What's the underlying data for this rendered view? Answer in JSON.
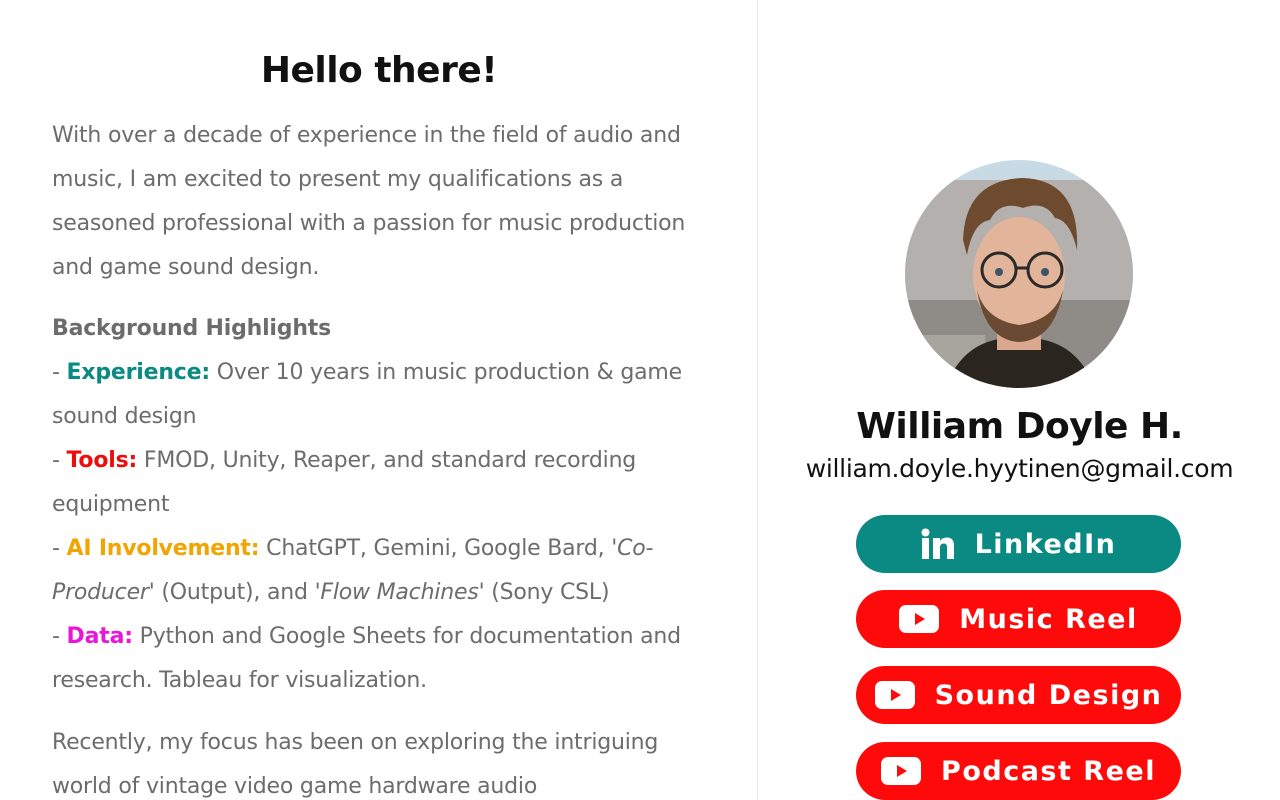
{
  "main": {
    "greeting": "Hello there!",
    "intro": "With over a decade of experience in the field of audio and music, I am excited to present my qualifications as a seasoned professional with a passion for music production and game sound design.",
    "highlights": {
      "heading": "Background Highlights",
      "dash": "- ",
      "experience": {
        "label": "Experience:",
        "text": " Over 10 years in music production & game sound design"
      },
      "tools": {
        "label": "Tools:",
        "text": " FMOD, Unity, Reaper, and standard recording equipment"
      },
      "ai": {
        "label": "AI Involvement:",
        "text_a": " ChatGPT, Gemini, Google Bard, ",
        "italic_a": "'Co-Producer'",
        "text_b": " (Output), and ",
        "italic_b": "'Flow Machines'",
        "text_c": " (Sony CSL)"
      },
      "data": {
        "label": "Data:",
        "text": " Python and Google Sheets for documentation and research. Tableau for visualization."
      }
    },
    "recent": "Recently, my focus has been on exploring the intriguing world of vintage video game hardware audio"
  },
  "profile": {
    "name": "William Doyle H.",
    "email": "william.doyle.hyytinen@gmail.com"
  },
  "links": {
    "linkedin": {
      "label": "LinkedIn",
      "icon": "linkedin-icon"
    },
    "music_reel": {
      "label": "Music Reel",
      "icon": "youtube-icon"
    },
    "sound_design": {
      "label": "Sound Design",
      "icon": "youtube-icon"
    },
    "podcast_reel": {
      "label": "Podcast Reel",
      "icon": "youtube-icon"
    }
  },
  "colors": {
    "experience": "#0b8a84",
    "tools": "#ee0d0d",
    "ai_involvement": "#f2a400",
    "data": "#e817d8",
    "linkedin_button": "#0b8a84",
    "youtube_button": "#ff0a0a"
  }
}
